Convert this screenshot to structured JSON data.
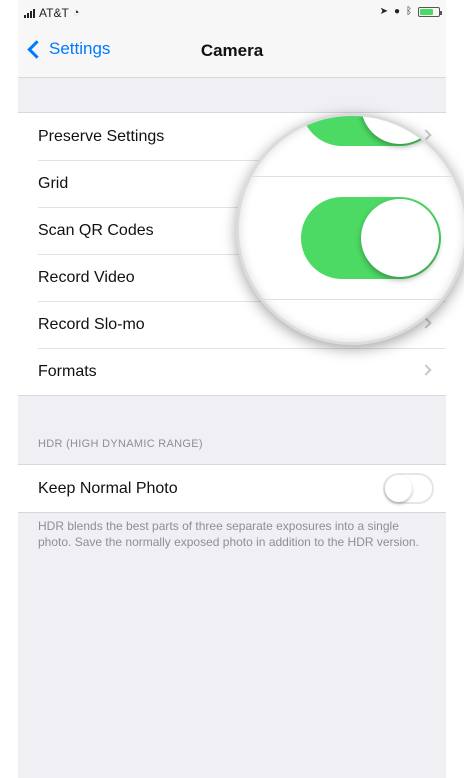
{
  "status_bar": {
    "carrier": "AT&T",
    "wifi_icon": "wifi-icon",
    "battery_level": 0.7,
    "colors": {
      "battery": "#4cd964"
    }
  },
  "nav": {
    "back_label": "Settings",
    "title": "Camera"
  },
  "settings_group": {
    "items": [
      {
        "label": "Preserve Settings"
      },
      {
        "label": "Grid"
      },
      {
        "label": "Scan QR Codes"
      },
      {
        "label": "Record Video"
      },
      {
        "label": "Record Slo-mo"
      },
      {
        "label": "Formats"
      }
    ]
  },
  "hdr_section": {
    "header": "HDR (HIGH DYNAMIC RANGE)",
    "keep_normal_photo": {
      "label": "Keep Normal Photo",
      "on": false
    },
    "footer": "HDR blends the best parts of three separate exposures into a single photo. Save the normally exposed photo in addition to the HDR version."
  },
  "magnifier": {
    "scan_qr_switch_on": true
  },
  "colors": {
    "accent": "#007aff",
    "switch_on": "#4cd964",
    "background": "#efeff4"
  }
}
